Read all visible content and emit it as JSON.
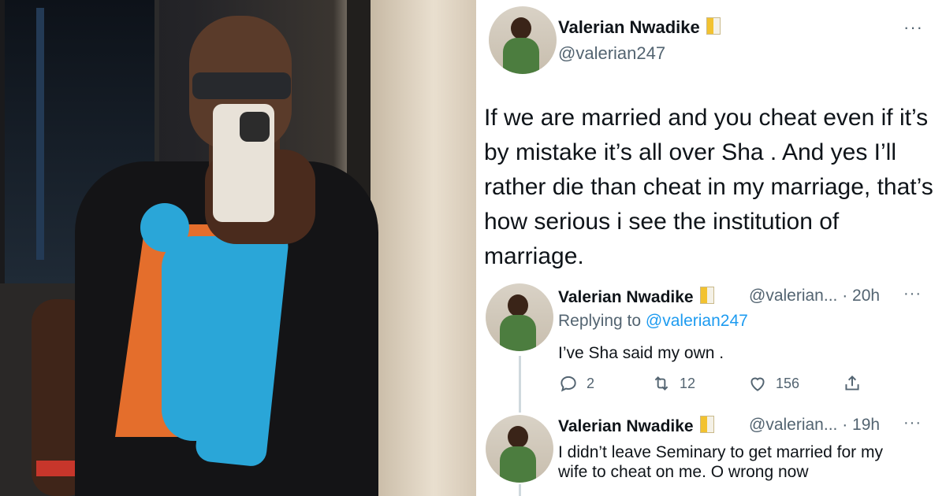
{
  "main_tweet": {
    "name": "Valerian Nwadike",
    "handle": "@valerian247",
    "more": "···",
    "text": "If we are married and you cheat even if it’s by mistake it’s all over Sha . And yes I’ll rather die than cheat in my marriage, that’s how serious i see the institution of marriage."
  },
  "reply1": {
    "name": "Valerian Nwadike",
    "handle_time": "@valerian... · 20h",
    "more": "···",
    "replying_prefix": "Replying to ",
    "replying_to": "@valerian247",
    "text": "I’ve Sha said my own .",
    "actions": {
      "replies": "2",
      "retweets": "12",
      "likes": "156"
    }
  },
  "reply2": {
    "name": "Valerian Nwadike",
    "handle_time": "@valerian... · 19h",
    "more": "···",
    "text": "I didn’t leave Seminary to get married for my wife to cheat on me. O wrong now"
  },
  "icons": [
    "flag-icon",
    "more-icon",
    "reply-icon",
    "retweet-icon",
    "like-icon",
    "share-icon"
  ],
  "colors": {
    "link": "#1d9bf0",
    "muted": "#536471",
    "text": "#0f1419"
  }
}
